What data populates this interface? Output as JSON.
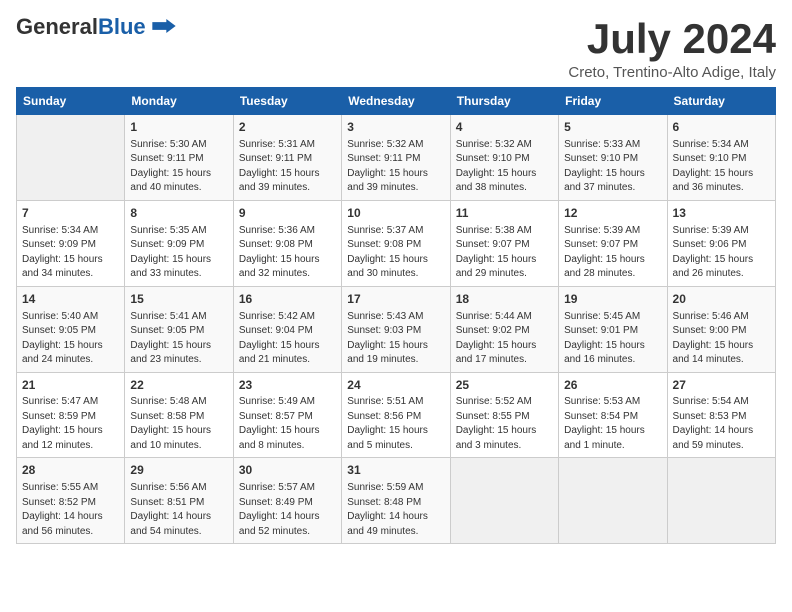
{
  "logo": {
    "general": "General",
    "blue": "Blue"
  },
  "title": "July 2024",
  "subtitle": "Creto, Trentino-Alto Adige, Italy",
  "days_header": [
    "Sunday",
    "Monday",
    "Tuesday",
    "Wednesday",
    "Thursday",
    "Friday",
    "Saturday"
  ],
  "weeks": [
    [
      {
        "day": "",
        "info": ""
      },
      {
        "day": "1",
        "info": "Sunrise: 5:30 AM\nSunset: 9:11 PM\nDaylight: 15 hours\nand 40 minutes."
      },
      {
        "day": "2",
        "info": "Sunrise: 5:31 AM\nSunset: 9:11 PM\nDaylight: 15 hours\nand 39 minutes."
      },
      {
        "day": "3",
        "info": "Sunrise: 5:32 AM\nSunset: 9:11 PM\nDaylight: 15 hours\nand 39 minutes."
      },
      {
        "day": "4",
        "info": "Sunrise: 5:32 AM\nSunset: 9:10 PM\nDaylight: 15 hours\nand 38 minutes."
      },
      {
        "day": "5",
        "info": "Sunrise: 5:33 AM\nSunset: 9:10 PM\nDaylight: 15 hours\nand 37 minutes."
      },
      {
        "day": "6",
        "info": "Sunrise: 5:34 AM\nSunset: 9:10 PM\nDaylight: 15 hours\nand 36 minutes."
      }
    ],
    [
      {
        "day": "7",
        "info": "Sunrise: 5:34 AM\nSunset: 9:09 PM\nDaylight: 15 hours\nand 34 minutes."
      },
      {
        "day": "8",
        "info": "Sunrise: 5:35 AM\nSunset: 9:09 PM\nDaylight: 15 hours\nand 33 minutes."
      },
      {
        "day": "9",
        "info": "Sunrise: 5:36 AM\nSunset: 9:08 PM\nDaylight: 15 hours\nand 32 minutes."
      },
      {
        "day": "10",
        "info": "Sunrise: 5:37 AM\nSunset: 9:08 PM\nDaylight: 15 hours\nand 30 minutes."
      },
      {
        "day": "11",
        "info": "Sunrise: 5:38 AM\nSunset: 9:07 PM\nDaylight: 15 hours\nand 29 minutes."
      },
      {
        "day": "12",
        "info": "Sunrise: 5:39 AM\nSunset: 9:07 PM\nDaylight: 15 hours\nand 28 minutes."
      },
      {
        "day": "13",
        "info": "Sunrise: 5:39 AM\nSunset: 9:06 PM\nDaylight: 15 hours\nand 26 minutes."
      }
    ],
    [
      {
        "day": "14",
        "info": "Sunrise: 5:40 AM\nSunset: 9:05 PM\nDaylight: 15 hours\nand 24 minutes."
      },
      {
        "day": "15",
        "info": "Sunrise: 5:41 AM\nSunset: 9:05 PM\nDaylight: 15 hours\nand 23 minutes."
      },
      {
        "day": "16",
        "info": "Sunrise: 5:42 AM\nSunset: 9:04 PM\nDaylight: 15 hours\nand 21 minutes."
      },
      {
        "day": "17",
        "info": "Sunrise: 5:43 AM\nSunset: 9:03 PM\nDaylight: 15 hours\nand 19 minutes."
      },
      {
        "day": "18",
        "info": "Sunrise: 5:44 AM\nSunset: 9:02 PM\nDaylight: 15 hours\nand 17 minutes."
      },
      {
        "day": "19",
        "info": "Sunrise: 5:45 AM\nSunset: 9:01 PM\nDaylight: 15 hours\nand 16 minutes."
      },
      {
        "day": "20",
        "info": "Sunrise: 5:46 AM\nSunset: 9:00 PM\nDaylight: 15 hours\nand 14 minutes."
      }
    ],
    [
      {
        "day": "21",
        "info": "Sunrise: 5:47 AM\nSunset: 8:59 PM\nDaylight: 15 hours\nand 12 minutes."
      },
      {
        "day": "22",
        "info": "Sunrise: 5:48 AM\nSunset: 8:58 PM\nDaylight: 15 hours\nand 10 minutes."
      },
      {
        "day": "23",
        "info": "Sunrise: 5:49 AM\nSunset: 8:57 PM\nDaylight: 15 hours\nand 8 minutes."
      },
      {
        "day": "24",
        "info": "Sunrise: 5:51 AM\nSunset: 8:56 PM\nDaylight: 15 hours\nand 5 minutes."
      },
      {
        "day": "25",
        "info": "Sunrise: 5:52 AM\nSunset: 8:55 PM\nDaylight: 15 hours\nand 3 minutes."
      },
      {
        "day": "26",
        "info": "Sunrise: 5:53 AM\nSunset: 8:54 PM\nDaylight: 15 hours\nand 1 minute."
      },
      {
        "day": "27",
        "info": "Sunrise: 5:54 AM\nSunset: 8:53 PM\nDaylight: 14 hours\nand 59 minutes."
      }
    ],
    [
      {
        "day": "28",
        "info": "Sunrise: 5:55 AM\nSunset: 8:52 PM\nDaylight: 14 hours\nand 56 minutes."
      },
      {
        "day": "29",
        "info": "Sunrise: 5:56 AM\nSunset: 8:51 PM\nDaylight: 14 hours\nand 54 minutes."
      },
      {
        "day": "30",
        "info": "Sunrise: 5:57 AM\nSunset: 8:49 PM\nDaylight: 14 hours\nand 52 minutes."
      },
      {
        "day": "31",
        "info": "Sunrise: 5:59 AM\nSunset: 8:48 PM\nDaylight: 14 hours\nand 49 minutes."
      },
      {
        "day": "",
        "info": ""
      },
      {
        "day": "",
        "info": ""
      },
      {
        "day": "",
        "info": ""
      }
    ]
  ]
}
